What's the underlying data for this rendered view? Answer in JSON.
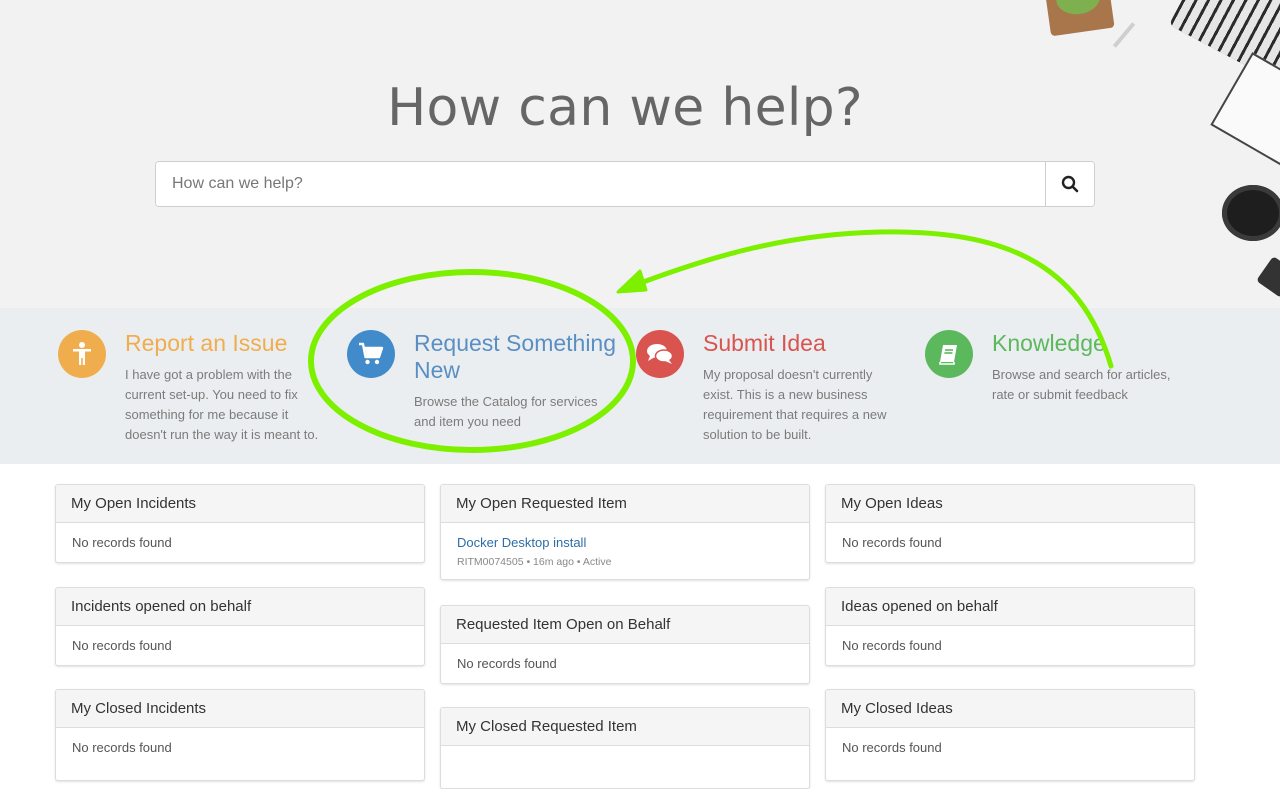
{
  "hero": {
    "title": "How can we help?",
    "search_placeholder": "How can we help?",
    "search_icon": "search-icon"
  },
  "quick_links": [
    {
      "title": "Report an Issue",
      "description": "I have got a problem with the current set-up. You need to fix something for me because it doesn't run the way it is meant to.",
      "icon": "person-icon",
      "color": "#f0ad4e"
    },
    {
      "title": "Request Something New",
      "description": "Browse the Catalog for services and item you need",
      "icon": "cart-icon",
      "color": "#428bca"
    },
    {
      "title": "Submit Idea",
      "description": "My proposal doesn't currently exist. This is a new business requirement that requires a new solution to be built.",
      "icon": "chat-icon",
      "color": "#d9534f"
    },
    {
      "title": "Knowledge",
      "description": "Browse and search for articles, rate or submit feedback",
      "icon": "book-icon",
      "color": "#5cb85c"
    }
  ],
  "panels": {
    "my_open_incidents": {
      "title": "My Open Incidents",
      "empty": "No records found"
    },
    "incidents_on_behalf": {
      "title": "Incidents opened on behalf",
      "empty": "No records found"
    },
    "my_closed_incidents": {
      "title": "My Closed Incidents",
      "empty": "No records found"
    },
    "my_open_requested_item": {
      "title": "My Open Requested Item",
      "item": {
        "label": "Docker Desktop install",
        "meta": "RITM0074505 • 16m ago • Active"
      }
    },
    "requested_item_on_behalf": {
      "title": "Requested Item Open on Behalf",
      "empty": "No records found"
    },
    "my_closed_requested_item": {
      "title": "My Closed Requested Item"
    },
    "my_open_ideas": {
      "title": "My Open Ideas",
      "empty": "No records found"
    },
    "ideas_on_behalf": {
      "title": "Ideas opened on behalf",
      "empty": "No records found"
    },
    "my_closed_ideas": {
      "title": "My Closed Ideas",
      "empty": "No records found"
    }
  },
  "annotation": {
    "color": "#7df000"
  }
}
